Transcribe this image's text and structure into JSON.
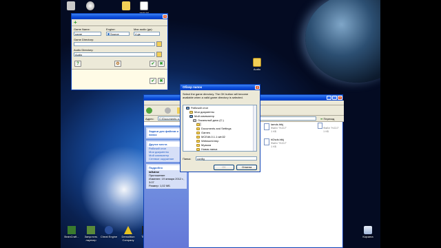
{
  "desktop": {
    "icons_top": [
      {
        "label": ""
      },
      {
        "label": ""
      },
      {
        "label": ""
      },
      {
        "label": "zack.txt"
      }
    ],
    "audio_folder": {
      "label": "Audio"
    },
    "bottom_icons": [
      {
        "label": "BrainCraft..."
      },
      {
        "label": "Запустить лаунчер"
      },
      {
        "label": "Cheat Engine"
      },
      {
        "label": "Demolition Company"
      },
      {
        "label": "The S..."
      }
    ],
    "recycle_bin": {
      "label": "Корзина"
    }
  },
  "small_app": {
    "title": "",
    "toolbar_label": "",
    "game_name_label": "Game Name:",
    "game_name_value": "name",
    "engine_label": "Engine:",
    "engine_value": "Source",
    "max_audio_label": "Max audio (gs):",
    "max_audio_value": "4 gs",
    "game_dir_label": "Game Directory:",
    "game_dir_value": "",
    "audio_dir_label": "Audio Directory:",
    "audio_dir_value": "Audio"
  },
  "explorer": {
    "address_label": "Адрес:",
    "address_value": "C:\\Documents a...",
    "go_label": "Переход",
    "tasks_title": "Задачи для файлов и папок",
    "other_places_title": "Другие места",
    "other_places": [
      "Рабочий стол",
      "Мои документы",
      "Мой компьютер",
      "Сетевое окружение"
    ],
    "details_title": "Подробно",
    "details_name": "lafkdme",
    "details_type": "Приложение",
    "details_modified": "Изменен: 19 января 2012 г., 3:07",
    "details_size": "Размер: 1,02 МБ",
    "files": [
      {
        "name": "lamds.htkj",
        "line1": "Файл \"HJ2J\"",
        "line2": "1 КБ"
      },
      {
        "name": "hl2sds.htkj",
        "line1": "Файл \"HJ2J\"",
        "line2": "1 КБ"
      }
    ],
    "extra_file": {
      "name": "",
      "line1": "Файл \"HJ2J\"",
      "line2": "1 КБ"
    }
  },
  "dialog": {
    "title": "Обзор папок",
    "description": "Select the game directory. The OK button will become available when a valid game directory is selected.",
    "tree": [
      {
        "label": "Рабочий стол",
        "indent": 0,
        "icon": "pc"
      },
      {
        "label": "Мои документы",
        "indent": 1,
        "icon": "docs"
      },
      {
        "label": "Мой компьютер",
        "indent": 1,
        "icon": "pc"
      },
      {
        "label": "Локальный диск (C:)",
        "indent": 2,
        "icon": "drive"
      },
      {
        "label": "",
        "indent": 3,
        "icon": "folder"
      },
      {
        "label": "Documents and Settings",
        "indent": 3,
        "icon": "folder"
      },
      {
        "label": "Games",
        "indent": 3,
        "icon": "folder"
      },
      {
        "label": "MCEdit-0.1.1.win32",
        "indent": 3,
        "icon": "folder"
      },
      {
        "label": "Webworld.tmp",
        "indent": 3,
        "icon": "folder"
      },
      {
        "label": "Музыка",
        "indent": 3,
        "icon": "folder"
      },
      {
        "label": "Новая папка",
        "indent": 3,
        "icon": "folder"
      }
    ],
    "folder_label": "Папка:",
    "folder_value": "config",
    "ok_label": "OK",
    "cancel_label": "Отмена"
  }
}
